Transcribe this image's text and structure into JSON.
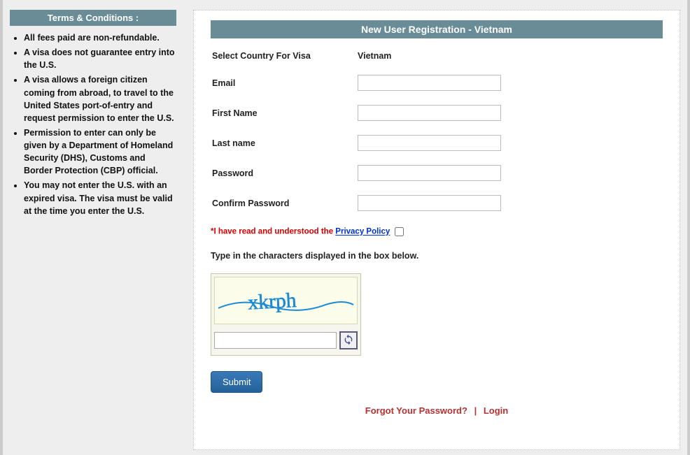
{
  "sidebar": {
    "title": "Terms & Conditions :",
    "items": [
      "All fees paid are non-refundable.",
      "A visa does not guarantee entry into the U.S.",
      "A visa allows a foreign citizen coming from abroad, to travel to the United States port-of-entry and request permission to enter the U.S.",
      "Permission to enter can only be given by a Department of Homeland Security (DHS), Customs and Border Protection (CBP) official.",
      "You may not enter the U.S. with an expired visa. The visa must be valid at the time you enter the U.S."
    ]
  },
  "form": {
    "title": "New User Registration - Vietnam",
    "country_label": "Select Country For Visa",
    "country_value": "Vietnam",
    "email_label": "Email",
    "first_name_label": "First Name",
    "last_name_label": "Last name",
    "password_label": "Password",
    "confirm_password_label": "Confirm Password",
    "policy_prefix": "*I have read and understood the ",
    "policy_link": "Privacy Policy",
    "captcha_label": "Type in the characters displayed in the box below.",
    "captcha_text": "xkrph",
    "submit_label": "Submit",
    "forgot_label": "Forgot Your Password?",
    "sep": "|",
    "login_label": "Login"
  }
}
